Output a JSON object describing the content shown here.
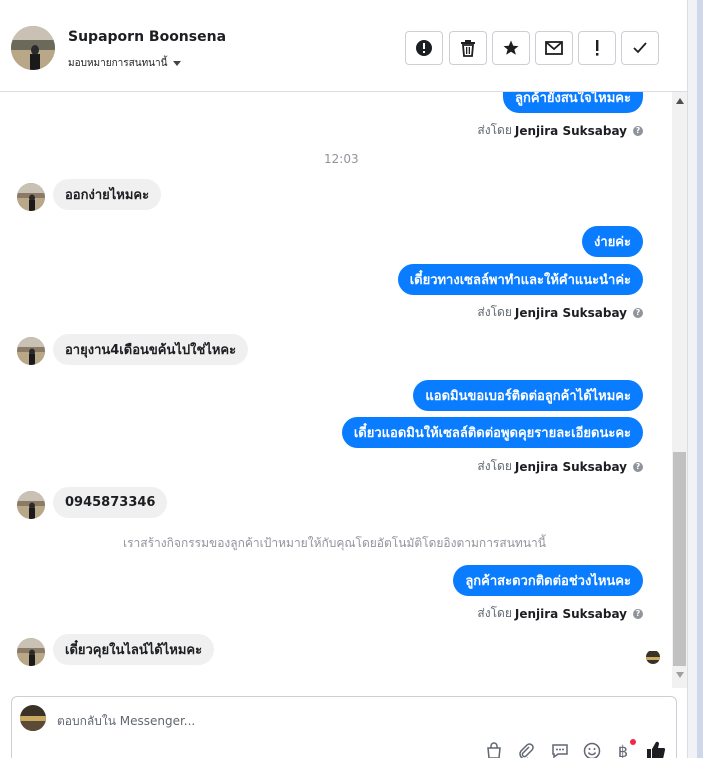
{
  "header": {
    "contact_name": "Supaporn Boonsena",
    "assign_label": "มอบหมายการสนทนานี้",
    "buttons": [
      {
        "name": "spam-button",
        "icon": "alert-circle-icon"
      },
      {
        "name": "delete-button",
        "icon": "trash-icon"
      },
      {
        "name": "star-button",
        "icon": "star-icon"
      },
      {
        "name": "unread-button",
        "icon": "envelope-icon"
      },
      {
        "name": "follow-up-button",
        "icon": "exclamation-icon"
      },
      {
        "name": "done-button",
        "icon": "check-icon"
      }
    ]
  },
  "thread": {
    "msg_out_0": "ลูกค้ายังสนใจไหมคะ",
    "sent_0_prefix": "ส่งโดย",
    "sent_0_name": "Jenjira Suksabay",
    "timestamp": "12:03",
    "msg_in_1": "ออกง่ายไหมคะ",
    "msg_out_2": "ง่ายค่ะ",
    "msg_out_3": "เดี๋ยวทางเซลล์พาทำและให้คำแนะนำค่ะ",
    "sent_1_prefix": "ส่งโดย",
    "sent_1_name": "Jenjira Suksabay",
    "msg_in_4": "อายุงาน4เดือนขค้นไปใช่ไหคะ",
    "msg_out_5": "แอดมินขอเบอร์ติดต่อลูกค้าได้ไหมคะ",
    "msg_out_6": "เดี๋ยวแอดมินให้เซลล์ติดต่อพูดคุยรายละเอียดนะคะ",
    "sent_2_prefix": "ส่งโดย",
    "sent_2_name": "Jenjira Suksabay",
    "msg_in_7": "0945873346",
    "system_note": "เราสร้างกิจกรรมของลูกค้าเป้าหมายให้กับคุณโดยอัตโนมัติโดยอิงตามการสนทนานี้",
    "msg_out_8": "ลูกค้าสะดวกติดต่อช่วงไหนคะ",
    "sent_3_prefix": "ส่งโดย",
    "sent_3_name": "Jenjira Suksabay",
    "msg_in_9": "เดี๋ยวคุยในไลน์ได้ไหมคะ",
    "help_glyph": "?"
  },
  "composer": {
    "placeholder": "ตอบกลับใน Messenger...",
    "baht_glyph": "฿",
    "tools": [
      "shopping-bag-icon",
      "paperclip-icon",
      "saved-replies-icon",
      "emoji-icon",
      "payment-icon",
      "thumbs-up-icon"
    ]
  },
  "colors": {
    "accent": "#0a7cff",
    "incoming_bubble": "#f0f0f0",
    "muted_text": "#90949c"
  }
}
